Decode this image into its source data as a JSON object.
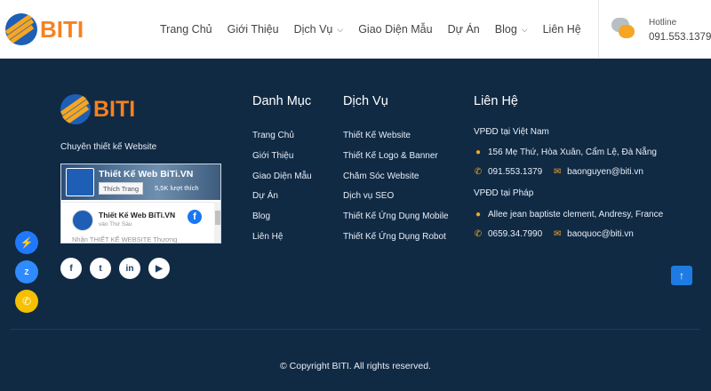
{
  "header": {
    "logo_text": "BITI",
    "nav": [
      {
        "label": "Trang Chủ",
        "chevron": false
      },
      {
        "label": "Giới Thiệu",
        "chevron": false
      },
      {
        "label": "Dịch Vụ",
        "chevron": true
      },
      {
        "label": "Giao Diện Mẫu",
        "chevron": false
      },
      {
        "label": "Dự Án",
        "chevron": false
      },
      {
        "label": "Blog",
        "chevron": true
      },
      {
        "label": "Liên Hệ",
        "chevron": false
      }
    ],
    "hotline_label": "Hotline",
    "hotline_number": "091.553.1379"
  },
  "footer": {
    "logo_text": "BITI",
    "tagline": "Chuyên thiết kế Website",
    "fb_widget": {
      "page_name": "Thiết Kế Web BiTi.VN",
      "like_button": "Thích Trang",
      "like_count": "5,5K lượt thích",
      "post_title": "Thiết Kế Web BiTi.VN",
      "post_time": "vào Thứ Sáu",
      "post_text": "Nhận THIẾT KẾ WEBSITE Thương"
    },
    "socials": [
      {
        "icon": "facebook-icon",
        "glyph": "f"
      },
      {
        "icon": "twitter-icon",
        "glyph": "t"
      },
      {
        "icon": "linkedin-icon",
        "glyph": "in"
      },
      {
        "icon": "youtube-icon",
        "glyph": "▶"
      }
    ],
    "danh_muc": {
      "title": "Danh Mục",
      "items": [
        "Trang Chủ",
        "Giới Thiệu",
        "Giao Diện Mẫu",
        "Dự Án",
        "Blog",
        "Liên Hệ"
      ]
    },
    "dich_vu": {
      "title": "Dịch Vụ",
      "items": [
        "Thiết Kế Website",
        "Thiết Kế Logo & Banner",
        "Chăm Sóc Website",
        "Dịch vụ SEO",
        "Thiết Kế Ứng Dụng Mobile",
        "Thiết Kế Ứng Dụng Robot"
      ]
    },
    "lien_he": {
      "title": "Liên Hệ",
      "vn_heading": "VPĐD tại Việt Nam",
      "vn_address": "156 Mẹ Thứ, Hòa Xuân, Cẩm Lệ, Đà Nẵng",
      "vn_phone": "091.553.1379",
      "vn_email": "baonguyen@biti.vn",
      "fr_heading": "VPĐD tại Pháp",
      "fr_address": "Allee jean baptiste clement, Andresy, France",
      "fr_phone": "0659.34.7990",
      "fr_email": "baoquoc@biti.vn"
    },
    "copyright": "© Copyright BITI. All rights reserved."
  },
  "colors": {
    "footer_bg": "#102a44",
    "accent_orange": "#f58220",
    "icon_gold": "#f5a623",
    "scroll_top_blue": "#1e7be3"
  }
}
